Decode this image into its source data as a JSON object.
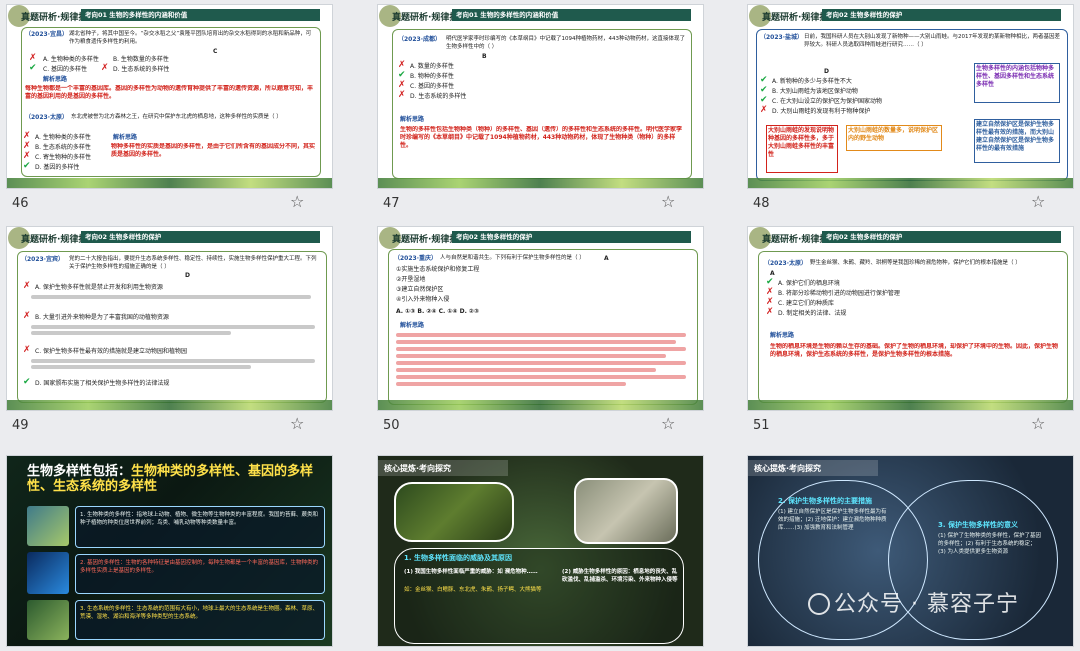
{
  "slides": [
    {
      "number": "46",
      "header_title": "真题研析·规律探寻",
      "header_bar": "考向01 生物的多样性的内涵和价值",
      "q1_tag": "（2023·宜昌）",
      "q1_text": "湖北省种子，将其中国至今。“杂交水稻之父”袁隆平团队培育出的杂交水稻得到的水稻和新品种，可作为粮食遗传多样性的利用。",
      "q1_answer": "C",
      "q1_opts": [
        "A. 生物种类的多样性",
        "B. 生物数量的多样性",
        "C. 基因的多样性",
        "D. 生态系统的多样性"
      ],
      "analysis_label": "解析思路",
      "analysis_red": "每种生物都是一个丰富的基因库。基因的多样性为动物的遗传育种提供了丰富的遗传资源，所以题意可知，丰富的基因利用的是基因的多样性。",
      "q2_tag": "（2023·太原）",
      "q2_text": "东北虎被誉为北方森林之王，在研究中保护东北虎的栖息地，这种多样性的实质是（  ）",
      "q2_answer": "D",
      "q2_opts": [
        "A. 生物种类的多样性",
        "B. 生态系统的多样性",
        "C. 寄生物种的多样性",
        "D. 基因的多样性"
      ],
      "analysis2_red": "物种多样性的实质是基因的多样性，是由于它们所含有的基因成分不同，其实质是基因的多样性。"
    },
    {
      "number": "47",
      "header_title": "真题研析·规律探寻",
      "header_bar": "考向01 生物的多样性的内涵和价值",
      "q_tag": "（2023·成都）",
      "q_text": "明代医学家李时珍编写的《本草纲目》中记载了1094种植物药材，443种动物药材，这直接体现了生物多样性中的（  ）",
      "q_answer": "B",
      "q_opts": [
        "A. 数量的多样性",
        "B. 物种的多样性",
        "C. 基因的多样性",
        "D. 生态系统的多样性"
      ],
      "analysis_label": "解析思路",
      "analysis_red": "生物的多样性包括生物种类（物种）的多样性、基因（遗传）的多样性和生态系统的多样性。明代医学家李时珍编写的《本草纲目》中记载了1094种植物药材，443种动物药材，体现了生物种类（物种）的多样性。"
    },
    {
      "number": "48",
      "header_title": "真题研析·规律探寻",
      "header_bar": "考向02 生物多样性的保护",
      "q_tag": "（2023·盐城）",
      "q_text": "日前，我国科研人员在大别山发现了新物种——大别山雨蛙。与2017年发现的某新物种相比，两者基因差异较大。科研人员选取四种雨蛙进行研究……（  ）",
      "q_answer": "D",
      "q_opts": [
        "A. 新物种的多少与多样性不大",
        "B. 大别山雨蛙为该地区保护动物",
        "C. 在大别山设立的保护区为保护国家动物",
        "D. 大别山雨蛙的发现有利于物种保护"
      ],
      "note_blue_1": "生物多样性的内涵包括物种多样性、基因多样性和生态系统多样性",
      "note_red_1": "大别山雨蛙的发现说明物种基因的多样性多，多于大别山雨蛙多样性的丰富性",
      "note_orange": "大别山雨蛙的数量多，说明保护区内的野生动物",
      "note_blue_2": "建立自然保护区是保护生物多样性最有效的措施，而大别山建立自然保护区是保护生物多样性的最有效措施"
    },
    {
      "number": "49",
      "header_title": "真题研析·规律探寻",
      "header_bar": "考向02 生物多样性的保护",
      "q_tag": "（2023·宜宾）",
      "q_text": "党的二十大报告指出，要提升生态系统多样性、稳定性、持续性，实施生物多样性保护重大工程。下列关于保护生物多样性的措施正确的是（  ）",
      "q_answer": "D",
      "q_opts": [
        "A. 保护生物多样性就是禁止开发和利用生物资源",
        "B. 大量引进外来物种是为了丰富我国的动植物资源",
        "C. 保护生物多样性最有效的措施就是建立动物园和植物园",
        "D. 国家颁布实施了相关保护生物多样性的法律法规"
      ]
    },
    {
      "number": "50",
      "header_title": "真题研析·规律探寻",
      "header_bar": "考向02 生物多样性的保护",
      "q_tag": "（2023·重庆）",
      "q_text": "人与自然是和谐共生。下列有利于保护生物多样性的是（  ）",
      "q_answer": "A",
      "q_opts": [
        "①实施生态系统保护和修复工程",
        "②开垦湿地",
        "③建立自然保护区",
        "④引入外来物种入侵"
      ],
      "q_combo": "A. ①③  B. ②④  C. ①④  D. ②③",
      "analysis_label": "解析思路"
    },
    {
      "number": "51",
      "header_title": "真题研析·规律探寻",
      "header_bar": "考向02 生物多样性的保护",
      "q_tag": "（2023·太原）",
      "q_text": "野生金丝猴、朱鹮、藏羚、珙桐等是我国珍稀的濒危物种，保护它们的根本措施是（  ）",
      "q_answer": "A",
      "q_opts": [
        "A. 保护它们的栖息环境",
        "B. 将部分珍稀动物引进的动物园进行保护管理",
        "C. 建立它们的种质库",
        "D. 制定相关的法律、法规"
      ],
      "analysis_label": "解析思路",
      "analysis_red": "生物的栖息环境是生物的赖以生存的基础。保护了生物的栖息环境，却保护了环境中的生物。因此，保护生物的栖息环境，保护生态系统的多样性，是保护生物多样性的根本措施。"
    },
    {
      "title_1": "生物多样性包括：",
      "title_2": "生物种类的多样性、基因的多样性、生态系统的多样性",
      "rows": [
        "1. 生物种类的多样性：指地球上动物、植物、微生物等生物种类的丰富程度。我国的苔藓、蕨类和种子植物的种类位居世界前列；鸟类、哺乳动物等种类数量丰富。",
        "2. 基因的多样性：生物的各种特征是由基因控制的，每种生物都是一个丰富的基因库，生物种类的多样性实质上是基因的多样性。",
        "3. 生态系统的多样性：生态系统的范围有大有小，地球上最大的生态系统是生物圈。森林、草原、荒漠、湿地、湖泊和海洋等多种类型的生态系统。"
      ]
    },
    {
      "header": "核心提炼·考向探究",
      "sec_title": "1. 生物多样性面临的威胁及其原因",
      "p1": "(1) 我国生物多样性面临严重的威胁：如 濒危物种……",
      "p2": "如：金丝猴、白鳍豚、东北虎、朱鹮、扬子鳄、大熊猫等",
      "p3": "(2) 威胁生物多样性的原因：栖息地的丧失、乱砍滥伐、乱捕滥杀、环境污染、外来物种入侵等"
    },
    {
      "header": "核心提炼·考向探究",
      "sec1_title": "2. 保护生物多样性的主要措施",
      "sec1_body": "(1) 建立自然保护区是保护生物多样性最为有效的措施；(2) 迁地保护：建立濒危物种种质库……(3) 加强教育和法制管理",
      "sec2_title": "3. 保护生物多样性的意义",
      "sec2_body": "(1) 保护了生物种类的多样性，保护了基因的多样性；(2) 有利于生态系统的稳定；(3) 为人类提供更多生物资源"
    }
  ],
  "watermark": "公众号 · 慕容子宁"
}
